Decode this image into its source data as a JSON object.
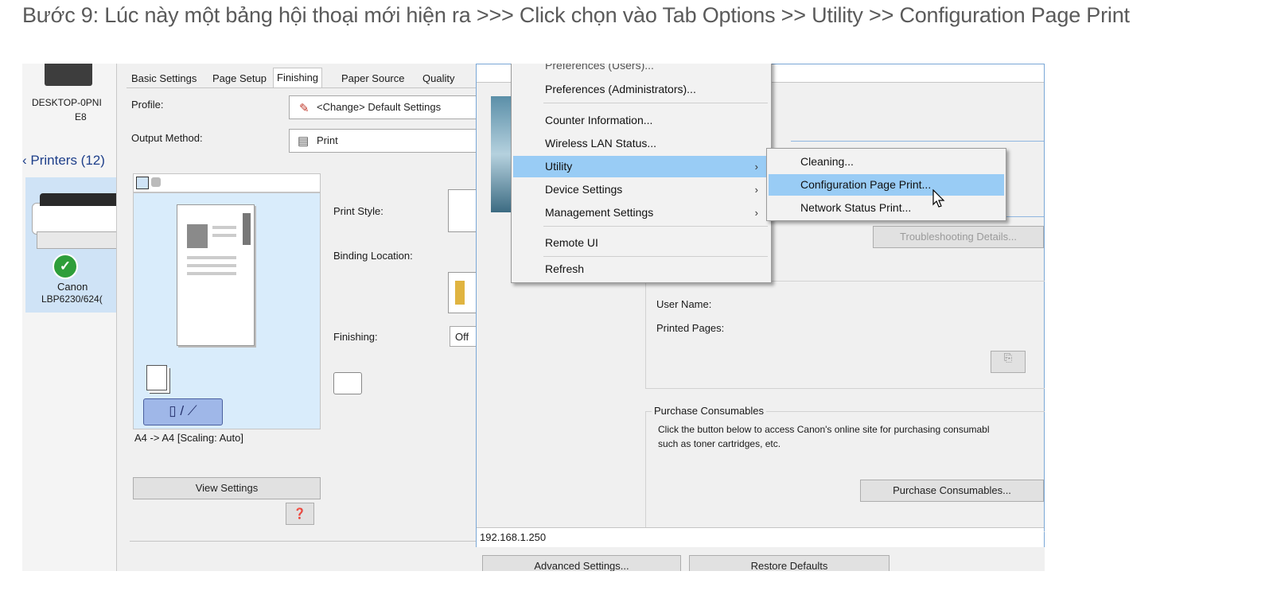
{
  "caption": "Bước 9: Lúc này một bảng hội thoại mới hiện ra >>> Click chọn vào Tab Options >> Utility >> Configuration Page Print",
  "left_panel": {
    "computer_name": "DESKTOP-0PNI",
    "computer_name_2": "E8",
    "printers_header": "Printers (12)",
    "printer_name_1": "Canon",
    "printer_name_2": "LBP6230/624("
  },
  "print_dialog": {
    "tabs": [
      "Basic Settings",
      "Page Setup",
      "Finishing",
      "Paper Source",
      "Quality"
    ],
    "active_tab": "Finishing",
    "profile_label": "Profile:",
    "profile_value": "<Change> Default Settings",
    "output_label": "Output Method:",
    "output_value": "Print",
    "print_style_label": "Print Style:",
    "binding_label": "Binding Location:",
    "finishing_label": "Finishing:",
    "finishing_value": "Off",
    "preview_caption": "A4 -> A4 [Scaling: Auto]",
    "view_settings": "View Settings"
  },
  "status_window": {
    "troubleshooting_btn": "Troubleshooting Details...",
    "user_name_label": "User Name:",
    "printed_pages_label": "Printed Pages:",
    "purchase_group": "Purchase Consumables",
    "purchase_text_1": "Click the button below to access Canon's online site for purchasing consumabl",
    "purchase_text_2": "such as toner cartridges, etc.",
    "purchase_btn": "Purchase Consumables...",
    "ip_address": "192.168.1.250",
    "advanced_btn": "Advanced Settings...",
    "restore_btn": "Restore Defaults"
  },
  "options_menu": {
    "top_partial": "Preferences (Users)...",
    "items": [
      "Preferences (Administrators)...",
      "Counter Information...",
      "Wireless LAN Status...",
      "Utility",
      "Device Settings",
      "Management Settings",
      "Remote UI",
      "Refresh"
    ],
    "selected": "Utility"
  },
  "utility_submenu": {
    "items": [
      "Cleaning...",
      "Configuration Page Print...",
      "Network Status Print..."
    ],
    "selected": "Configuration Page Print..."
  },
  "colors": {
    "menu_highlight": "#99ccf5",
    "preview_bg": "#d9ecfb",
    "check_green": "#2e9e3a"
  }
}
